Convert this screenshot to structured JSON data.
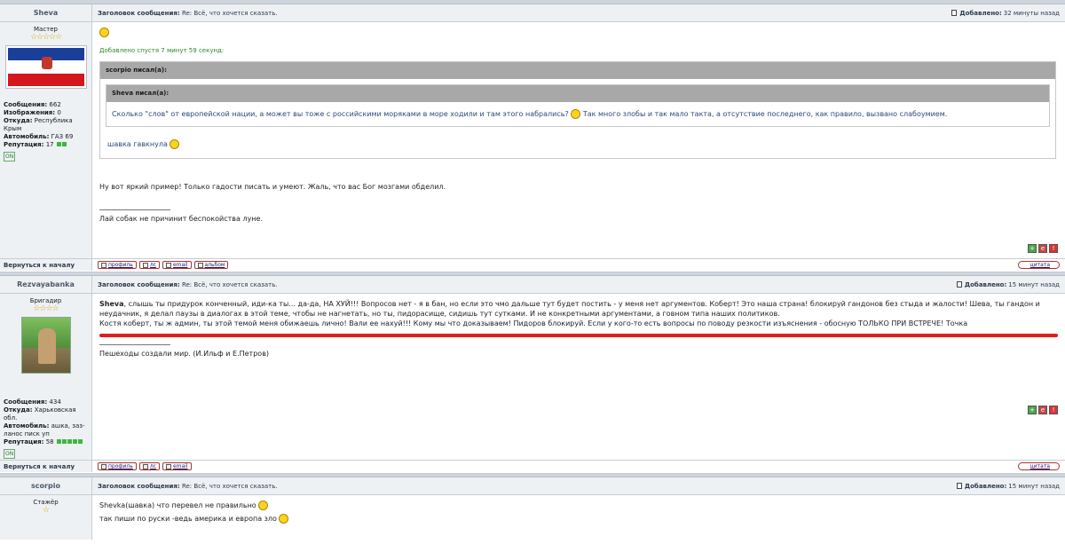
{
  "labels": {
    "subject": "Заголовок сообщения:",
    "added": "Добавлено:",
    "back_to_top": "Вернуться к началу",
    "wrote_suffix": "писал(а):",
    "posts": "Сообщения:",
    "images": "Изображения:",
    "from": "Откуда:",
    "car": "Автомобиль:",
    "reputation": "Репутация:",
    "online": "ON",
    "profile": "профиль",
    "pm": "лс",
    "email": "email",
    "album": "альбом",
    "quote": "цитата"
  },
  "colors": {
    "accent_red": "#e31b1b",
    "edited_green": "#2a8a2a",
    "quote_text": "#2a4a7a",
    "star": "#d4a400"
  },
  "posts": [
    {
      "author": "Sheva",
      "subject": "Re: Всё, что хочется сказать.",
      "time": "32 минуты назад",
      "rank": "Мастер",
      "stars": "☆☆☆☆☆",
      "avatar": "crimea-flag",
      "info": {
        "posts": "662",
        "images": "0",
        "from": "Республика Крым",
        "car": "ГАЗ 69",
        "reputation": "17"
      },
      "edited": "Добавлено спустя 7 минут 59 секунд:",
      "quote_outer_author": "scorpio",
      "quote_inner_author": "Sheva",
      "quote_inner_text_1": "Сколько \"слов\" от европейской нации, а может вы тоже с российскими моряками в море ходили и там этого набрались?",
      "quote_inner_text_2": "Так много злобы и так мало такта, а отсутствие последнего, как правило, вызвано слабоумием.",
      "quote_tail": "шавка гавкнула",
      "message": "Ну вот яркий пример! Только гадости писать и умеют. Жаль, что вас Бог мозгами обделил.",
      "signature": "Лай собак не причинит беспокойства луне."
    },
    {
      "author": "Rezvayabanka",
      "subject": "Re: Всё, что хочется сказать.",
      "time": "15 минут назад",
      "rank": "Бригадир",
      "stars": "☆☆☆☆",
      "avatar": "photo",
      "info": {
        "posts": "434",
        "from": "Харьковская обл.",
        "car": "ашка, заз-ланос пиcк уп",
        "reputation": "58"
      },
      "mention": "Sheva",
      "message_1": ", слышь ты придурок конченный, иди-ка ты... да-да, НА ХУЙ!!! Вопросов нет - я в бан, но если это чмо дальше тут будет постить - у меня нет аргументов. Коберт! Это наша страна! блокируй гандонов без стыда и жалости! Шева, ты гандон и неудачник, я делал паузы в диалогах в этой теме, чтобы не нагнетать, но ты, пидорасище, сидишь тут сутками. И не конкретными аргументами, а говном типа наших политиков.",
      "message_2": "Костя коберт, ты ж админ, ты этой темой меня обижаешь лично! Вали ее нахуй!!! Кому мы что доказываем! Пидоров блокируй. Если у кого-то есть вопросы по поводу резкости изъяснения - обосную ТОЛЬКО ПРИ ВСТРЕЧЕ! Точка",
      "signature": "Пешеходы создали мир. (И.Ильф и Е.Петров)"
    },
    {
      "author": "scorpio",
      "subject": "Re: Всё, что хочется сказать.",
      "time": "15 минут назад",
      "rank": "Стажёр",
      "stars": "☆",
      "message_1": "Shevka(шавка) что перевел не правильно",
      "message_2": "так пиши по руски -ведь америка и европа зло"
    }
  ]
}
